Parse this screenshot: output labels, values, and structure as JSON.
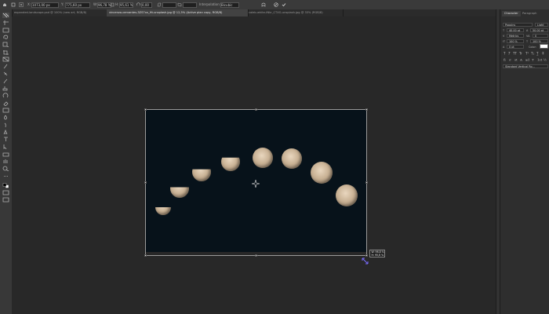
{
  "options_bar": {
    "x_value": "1073,00 px",
    "y_value": "775,60 px",
    "w_value": "96,78 %",
    "h_value": "95,61 %",
    "rotate_value": "0,00",
    "interpolation_label": "Interpolation:",
    "interpolation_value": "Bicubic"
  },
  "tabs": [
    {
      "label": "expanded-landscape.psd @ 100% (new art, RGB/8)"
    },
    {
      "label": "vincenzo-cervantes-3ZS7xx_Ht-unsplash.jpg @ 12,5% (Active plan copy, RGB/8)",
      "active": true
    },
    {
      "label": "caleb-white-tNkr_CTXG-unsplash.jpg @ 33% (RGB/8)"
    }
  ],
  "panel": {
    "tabs": [
      "Character",
      "Paragraph"
    ],
    "font_family": "Poppins",
    "font_style": "Light",
    "font_size": "40,00 pt",
    "leading": "50,00 pt",
    "kerning": "Metrics",
    "tracking": "0",
    "vertical_scale": "100 %",
    "horizontal_scale": "100 %",
    "baseline_shift": "0 pt",
    "color_label": "Color:",
    "language": "Standard Vertical Ro..."
  },
  "hud": {
    "w": "W: 96,8 %",
    "h": "H: 95,6 %"
  },
  "moons": [
    {
      "phase": 0.1
    },
    {
      "phase": 0.2
    },
    {
      "phase": 0.35
    },
    {
      "phase": 0.5
    },
    {
      "phase": 0.65
    },
    {
      "phase": 0.8
    },
    {
      "phase": 0.9
    },
    {
      "phase": 1.0
    }
  ]
}
